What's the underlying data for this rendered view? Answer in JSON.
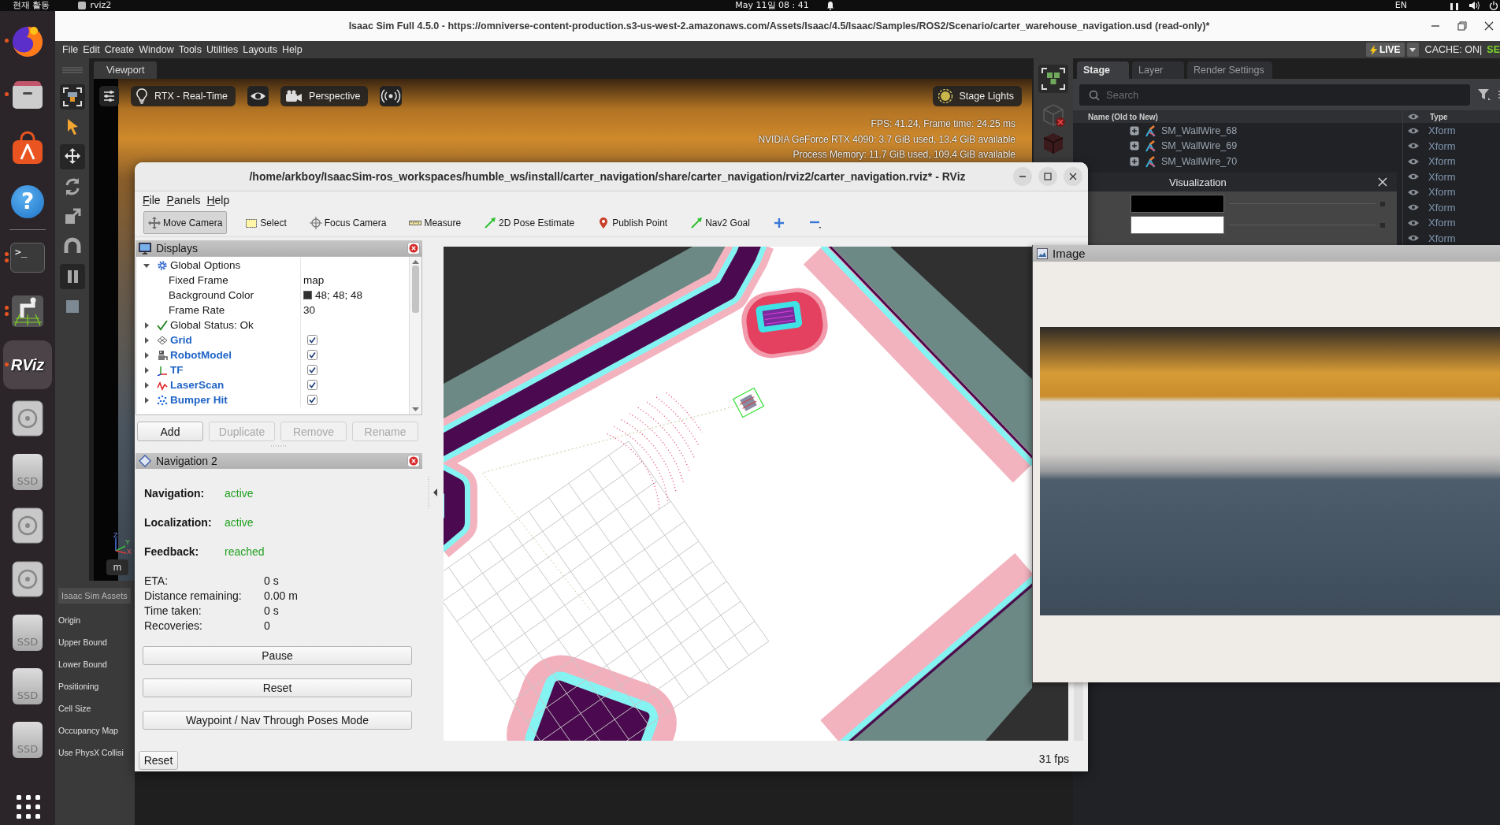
{
  "top_bar": {
    "activities": "현재 활동",
    "app_menu": "rviz2",
    "clock": "May 11일 08 : 41",
    "input_source": "EN"
  },
  "dock": {
    "groups": [
      {
        "items": [
          {
            "kind": "firefox",
            "running": true,
            "multiple_windows": false,
            "selected": false
          },
          {
            "kind": "files",
            "running": true,
            "multiple_windows": false,
            "selected": false
          },
          {
            "kind": "app-center",
            "running": false,
            "selected": false
          },
          {
            "kind": "help",
            "glyph": "?",
            "running": false,
            "selected": false
          }
        ]
      },
      {
        "items": [
          {
            "kind": "terminal",
            "glyph": ">_",
            "running": true,
            "multiple_windows": true,
            "selected": false
          },
          {
            "kind": "robot-arm",
            "running": true,
            "multiple_windows": true,
            "selected": false
          },
          {
            "kind": "rviz",
            "glyph": "RViz",
            "running": true,
            "multiple_windows": false,
            "selected": true
          },
          {
            "kind": "disc",
            "running": false,
            "selected": false
          },
          {
            "kind": "ssd",
            "glyph": "SSD",
            "running": false,
            "selected": false
          },
          {
            "kind": "disc",
            "running": false,
            "selected": false
          },
          {
            "kind": "disc",
            "running": false,
            "selected": false
          },
          {
            "kind": "ssd",
            "glyph": "SSD",
            "running": false,
            "selected": false
          },
          {
            "kind": "ssd",
            "glyph": "SSD",
            "running": false,
            "selected": false
          },
          {
            "kind": "ssd",
            "glyph": "SSD",
            "running": false,
            "selected": false
          }
        ]
      }
    ]
  },
  "isaac_sim": {
    "title": "Isaac Sim Full 4.5.0 - https://omniverse-content-production.s3-us-west-2.amazonaws.com/Assets/Isaac/4.5/Isaac/Samples/ROS2/Scenario/carter_warehouse_navigation.usd (read-only)*",
    "menu": [
      "File",
      "Edit",
      "Create",
      "Window",
      "Tools",
      "Utilities",
      "Layouts",
      "Help"
    ],
    "live_button": "LIVE",
    "cache_status": "CACHE: ON|",
    "status_text": "SE",
    "tools": [
      {
        "kind": "frame-select",
        "selected": false
      },
      {
        "kind": "pointer",
        "selected": true
      },
      {
        "kind": "move",
        "selected": false
      },
      {
        "kind": "rotate",
        "selected": false
      },
      {
        "kind": "scale",
        "selected": false
      },
      {
        "kind": "snap",
        "selected": false
      },
      {
        "kind": "pause",
        "selected": false
      },
      {
        "kind": "stop",
        "selected": false
      }
    ],
    "viewport": {
      "tab": "Viewport",
      "renderer": "RTX - Real-Time",
      "camera": "Perspective",
      "lights": "Stage Lights",
      "stats": [
        "FPS: 41.24, Frame time: 24.25 ms",
        "NVIDIA GeForce RTX 4090: 3.7 GiB used, 13.4 GiB available",
        "Process Memory: 11.7 GiB used, 109.4 GiB available"
      ],
      "axis_labels": [
        "Z",
        "Y",
        "X"
      ],
      "unit": "m"
    },
    "assets_panel": {
      "tab": "Isaac Sim Assets",
      "fields": [
        "Origin",
        "Upper Bound",
        "Lower Bound",
        "Positioning",
        "Cell Size",
        "Occupancy Map",
        "Use PhysX Collisi"
      ]
    },
    "stage": {
      "tabs": [
        {
          "label": "Stage",
          "selected": true
        },
        {
          "label": "Layer",
          "selected": false
        },
        {
          "label": "Render Settings",
          "selected": false
        }
      ],
      "search": {
        "placeholder": "Search"
      },
      "columns": [
        "Name (Old to New)",
        "Type"
      ],
      "rows": [
        {
          "name": "SM_WallWire_68",
          "type": "Xform"
        },
        {
          "name": "SM_WallWire_69",
          "type": "Xform"
        },
        {
          "name": "SM_WallWire_70",
          "type": "Xform"
        },
        {
          "type": "Xform"
        },
        {
          "type": "Xform"
        },
        {
          "type": "Xform"
        },
        {
          "type": "Xform"
        },
        {
          "type": "Xform"
        }
      ]
    },
    "visualization": {
      "title": "Visualization",
      "swatches": [
        {
          "color": "#000000"
        },
        {
          "color": "#ffffff"
        }
      ]
    }
  },
  "rviz": {
    "title": "/home/arkboy/IsaacSim-ros_workspaces/humble_ws/install/carter_navigation/share/carter_navigation/rviz2/carter_navigation.rviz* - RViz",
    "menu": [
      "File",
      "Panels",
      "Help"
    ],
    "tools": [
      {
        "kind": "move-camera",
        "label": "Move Camera",
        "selected": true
      },
      {
        "kind": "select",
        "label": "Select",
        "selected": false
      },
      {
        "kind": "focus-camera",
        "label": "Focus Camera",
        "selected": false
      },
      {
        "kind": "measure",
        "label": "Measure",
        "selected": false
      },
      {
        "kind": "pose-estimate",
        "label": "2D Pose Estimate",
        "selected": false
      },
      {
        "kind": "publish-point",
        "label": "Publish Point",
        "selected": false
      },
      {
        "kind": "nav-goal",
        "label": "Nav2 Goal",
        "selected": false
      },
      {
        "kind": "add",
        "selected": false
      },
      {
        "kind": "remove",
        "selected": false
      }
    ],
    "displays": {
      "title": "Displays",
      "tree": [
        {
          "kind": "options",
          "name": "Global Options",
          "expanded": true,
          "children": [
            {
              "name": "Fixed Frame",
              "value": "map"
            },
            {
              "name": "Background Color",
              "value": "48; 48; 48",
              "color": "#303030"
            },
            {
              "name": "Frame Rate",
              "value": "30"
            }
          ]
        },
        {
          "kind": "status",
          "name": "Global Status: Ok",
          "expanded": false
        },
        {
          "kind": "grid",
          "name": "Grid",
          "expanded": false,
          "checked": true
        },
        {
          "kind": "robot-model",
          "name": "RobotModel",
          "expanded": false,
          "checked": true
        },
        {
          "kind": "tf",
          "name": "TF",
          "expanded": false,
          "checked": true
        },
        {
          "kind": "laser-scan",
          "name": "LaserScan",
          "expanded": false,
          "checked": true
        },
        {
          "kind": "bumper-hit",
          "name": "Bumper Hit",
          "expanded": false,
          "checked": true
        }
      ],
      "buttons": [
        {
          "label": "Add",
          "disabled": false
        },
        {
          "label": "Duplicate",
          "disabled": true
        },
        {
          "label": "Remove",
          "disabled": true
        },
        {
          "label": "Rename",
          "disabled": true
        }
      ]
    },
    "navigation": {
      "title": "Navigation 2",
      "status": [
        {
          "label": "Navigation:",
          "value": "active"
        },
        {
          "label": "Localization:",
          "value": "active"
        },
        {
          "label": "Feedback:",
          "value": "reached"
        }
      ],
      "stats": [
        {
          "label": "ETA:",
          "value": "0 s"
        },
        {
          "label": "Distance remaining:",
          "value": "0.00 m"
        },
        {
          "label": "Time taken:",
          "value": "0 s"
        },
        {
          "label": "Recoveries:",
          "value": "0"
        }
      ],
      "buttons": [
        "Pause",
        "Reset",
        "Waypoint / Nav Through Poses Mode"
      ]
    },
    "reset_button": "Reset",
    "fps": "31 fps"
  },
  "image_panel": {
    "title": "Image"
  }
}
